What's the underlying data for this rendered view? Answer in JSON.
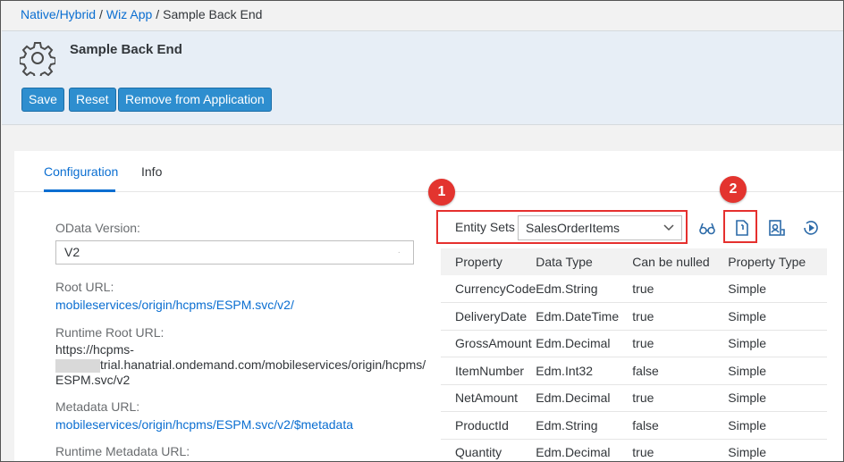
{
  "breadcrumb": {
    "item1": "Native/Hybrid",
    "item2": "Wiz App",
    "separator": "/",
    "current": "Sample Back End"
  },
  "header": {
    "title": "Sample Back End",
    "icon": "gear-icon",
    "buttons": {
      "save": "Save",
      "reset": "Reset",
      "remove": "Remove from Application"
    }
  },
  "tabs": {
    "configuration": "Configuration",
    "info": "Info"
  },
  "config": {
    "odata_version_label": "OData Version:",
    "odata_version_value": "V2",
    "root_url_label": "Root URL:",
    "root_url_value": "mobileservices/origin/hcpms/ESPM.svc/v2/",
    "runtime_root_url_label": "Runtime Root URL:",
    "runtime_root_url_line1": "https://hcpms-",
    "runtime_root_url_line2": "trial.hanatrial.ondemand.com/mobileservices/origin/hcpms/",
    "runtime_root_url_line3": "ESPM.svc/v2",
    "metadata_url_label": "Metadata URL:",
    "metadata_url_value": "mobileservices/origin/hcpms/ESPM.svc/v2/$metadata",
    "runtime_metadata_url_label": "Runtime Metadata URL:"
  },
  "entity": {
    "label": "Entity Sets",
    "selected": "SalesOrderItems"
  },
  "toolbar_icons": [
    "glasses-icon",
    "document-icon",
    "contact-icon",
    "play-icon"
  ],
  "callouts": {
    "badge1": "1",
    "badge2": "2",
    "color": "#e3342f"
  },
  "table": {
    "headers": [
      "Property",
      "Data Type",
      "Can be nulled",
      "Property Type"
    ],
    "rows": [
      [
        "CurrencyCode",
        "Edm.String",
        "true",
        "Simple"
      ],
      [
        "DeliveryDate",
        "Edm.DateTime",
        "true",
        "Simple"
      ],
      [
        "GrossAmount",
        "Edm.Decimal",
        "true",
        "Simple"
      ],
      [
        "ItemNumber",
        "Edm.Int32",
        "false",
        "Simple"
      ],
      [
        "NetAmount",
        "Edm.Decimal",
        "true",
        "Simple"
      ],
      [
        "ProductId",
        "Edm.String",
        "false",
        "Simple"
      ],
      [
        "Quantity",
        "Edm.Decimal",
        "true",
        "Simple"
      ]
    ]
  },
  "colors": {
    "accent": "#0a6ed1",
    "button": "#2e8ecf",
    "header_bg": "#e7eef6"
  }
}
